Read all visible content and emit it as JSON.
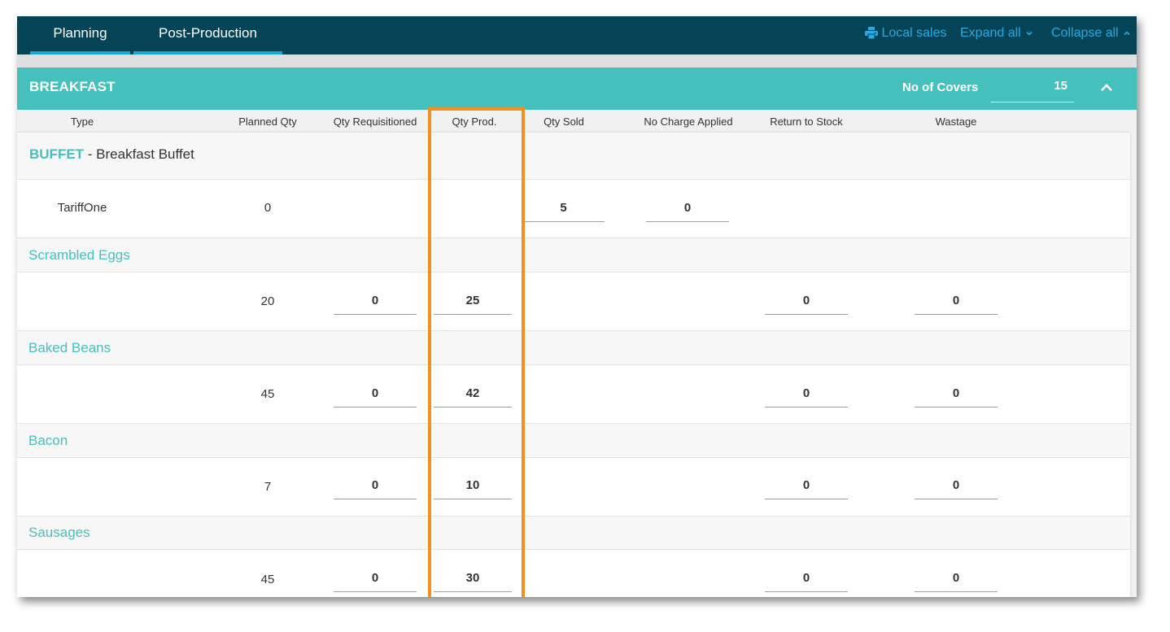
{
  "nav": {
    "tabs": [
      {
        "label": "Planning"
      },
      {
        "label": "Post-Production"
      }
    ],
    "local_sales": "Local sales",
    "expand_all": "Expand all",
    "collapse_all": "Collapse all",
    "accent_color": "#27a9e1"
  },
  "section": {
    "title": "BREAKFAST",
    "covers_label": "No of Covers",
    "covers_value": "15"
  },
  "columns": [
    "Type",
    "Planned Qty",
    "Qty Requisitioned",
    "Qty Prod.",
    "Qty Sold",
    "No Charge Applied",
    "Return to Stock",
    "Wastage"
  ],
  "buffet": {
    "code": "BUFFET",
    "name": " - Breakfast Buffet",
    "tariff": {
      "label": "TariffOne",
      "planned": "0",
      "qty_sold": "5",
      "no_charge": "0"
    }
  },
  "items": [
    {
      "name": "Scrambled Eggs",
      "planned": "20",
      "requisitioned": "0",
      "produced": "25",
      "return_to_stock": "0",
      "wastage": "0"
    },
    {
      "name": "Baked Beans",
      "planned": "45",
      "requisitioned": "0",
      "produced": "42",
      "return_to_stock": "0",
      "wastage": "0"
    },
    {
      "name": "Bacon",
      "planned": "7",
      "requisitioned": "0",
      "produced": "10",
      "return_to_stock": "0",
      "wastage": "0"
    },
    {
      "name": "Sausages",
      "planned": "45",
      "requisitioned": "0",
      "produced": "30",
      "return_to_stock": "0",
      "wastage": "0"
    }
  ],
  "colors": {
    "nav_bg": "#054457",
    "section_bg": "#46c0bd",
    "highlight": "#f0901e",
    "tab_underline": "#1ca7d8"
  }
}
